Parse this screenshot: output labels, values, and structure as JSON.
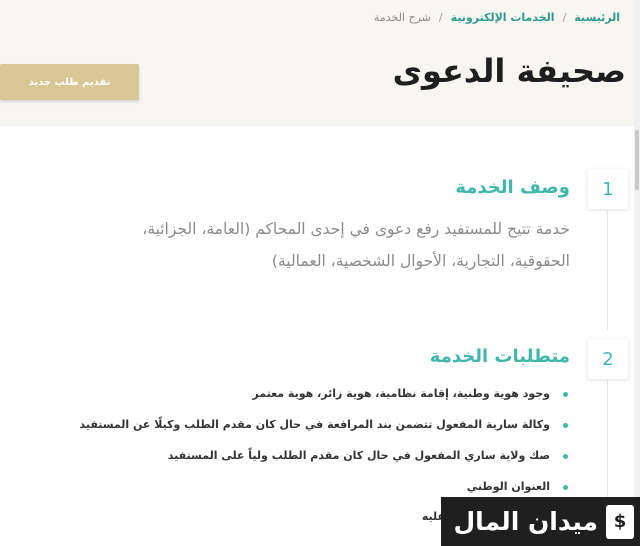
{
  "breadcrumb": {
    "home": "الرئيسية",
    "separator": "/",
    "eservices": "الخدمات الإلكترونية",
    "current": "شرح الخدمة"
  },
  "page_title": "صحيفة الدعوى",
  "new_request_label": "تقديم طلب جديد",
  "sections": [
    {
      "number": "1",
      "title": "وصف الخدمة",
      "line1": "خدمة تتيح للمستفيد رفع دعوى في إحدى المحاكم (العامة، الجزائية،",
      "line2": "الحقوقية، التجارية، الأحوال الشخصية، العمالية)"
    },
    {
      "number": "2",
      "title": "متطلبات الخدمة",
      "items": [
        "وجود هوية وطنية، إقامة نظامية، هوية زائر، هوية معتمر",
        "وكالة سارية المفعول تتضمن بند المرافعة في حال كان مقدم الطلب وكيلًا عن المستفيد",
        "صك ولاية ساري المفعول في حال كان مقدم الطلب ولياً على المستفيد",
        "العنوان الوطني"
      ],
      "partial_item": "عليه"
    }
  ],
  "watermark": {
    "text": "ميدان المال",
    "icon": "$"
  },
  "colors": {
    "accent": "#3fb8ab",
    "button": "#d8c694",
    "header_bg": "#f8f6f1"
  }
}
